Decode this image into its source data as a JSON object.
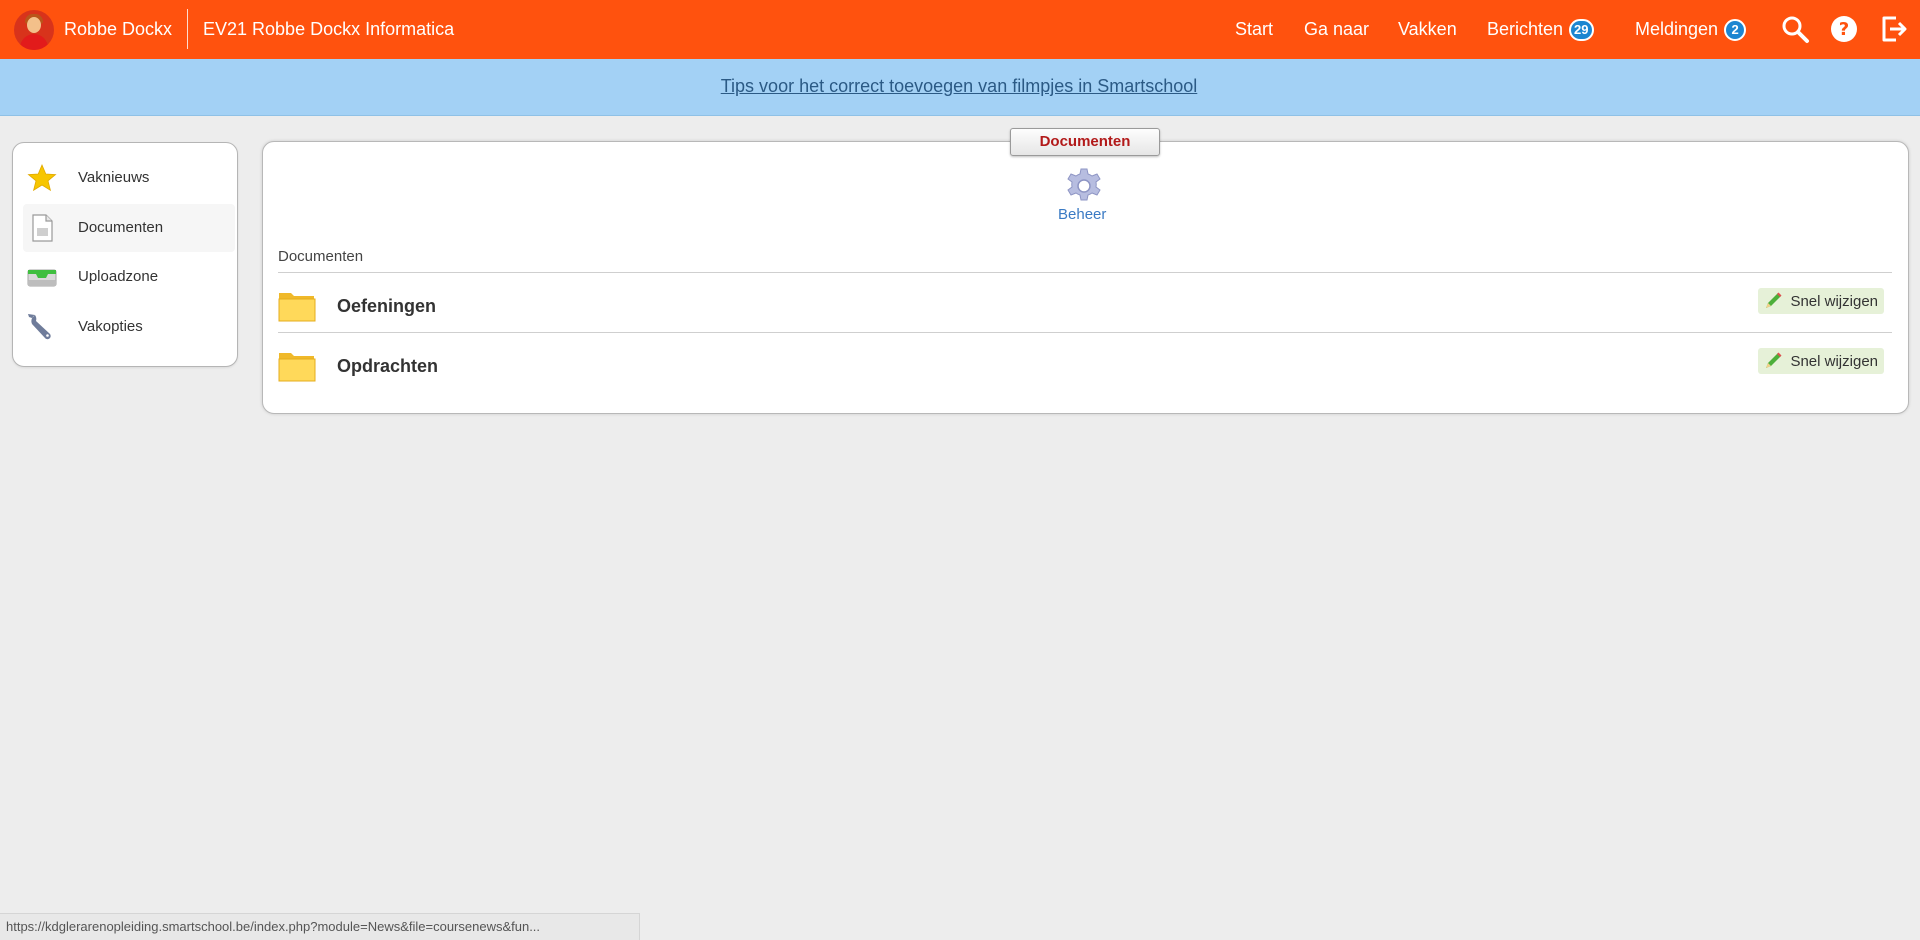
{
  "header": {
    "user_name": "Robbe Dockx",
    "course_title": "EV21 Robbe Dockx Informatica",
    "nav": [
      {
        "label": "Start"
      },
      {
        "label": "Ga naar"
      },
      {
        "label": "Vakken"
      },
      {
        "label": "Berichten",
        "badge": "29"
      },
      {
        "label": "Meldingen",
        "badge": "2"
      }
    ],
    "icons": [
      "search-icon",
      "help-icon",
      "logout-icon"
    ],
    "accent_color": "#ff520e",
    "badge_color": "#1c86d1"
  },
  "banner": {
    "link_text": "Tips voor het correct toevoegen van filmpjes in Smartschool"
  },
  "sidebar": {
    "items": [
      {
        "label": "Vaknieuws",
        "icon": "star-icon"
      },
      {
        "label": "Documenten",
        "icon": "document-icon",
        "active": true
      },
      {
        "label": "Uploadzone",
        "icon": "inbox-icon"
      },
      {
        "label": "Vakopties",
        "icon": "wrench-icon"
      }
    ]
  },
  "main": {
    "tab_label": "Documenten",
    "beheer_label": "Beheer",
    "section_title": "Documenten",
    "folders": [
      {
        "name": "Oefeningen",
        "action": "Snel wijzigen"
      },
      {
        "name": "Opdrachten",
        "action": "Snel wijzigen"
      }
    ]
  },
  "statusbar": {
    "url": "https://kdglerarenopleiding.smartschool.be/index.php?module=News&file=coursenews&fun..."
  }
}
